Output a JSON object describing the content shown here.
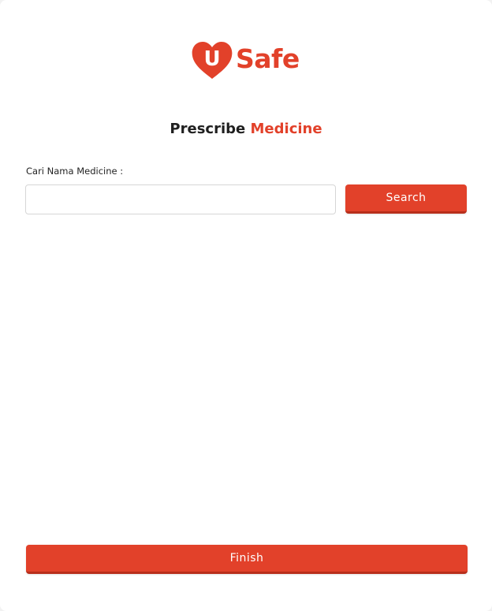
{
  "brand": {
    "logo_letter": "U",
    "logo_text": "Safe",
    "color": "#e2412a"
  },
  "header": {
    "title_prefix": "Prescribe",
    "title_accent": "Medicine"
  },
  "search": {
    "label": "Cari Nama Medicine :",
    "value": "",
    "placeholder": "",
    "button_label": "Search"
  },
  "footer": {
    "finish_label": "Finish"
  }
}
